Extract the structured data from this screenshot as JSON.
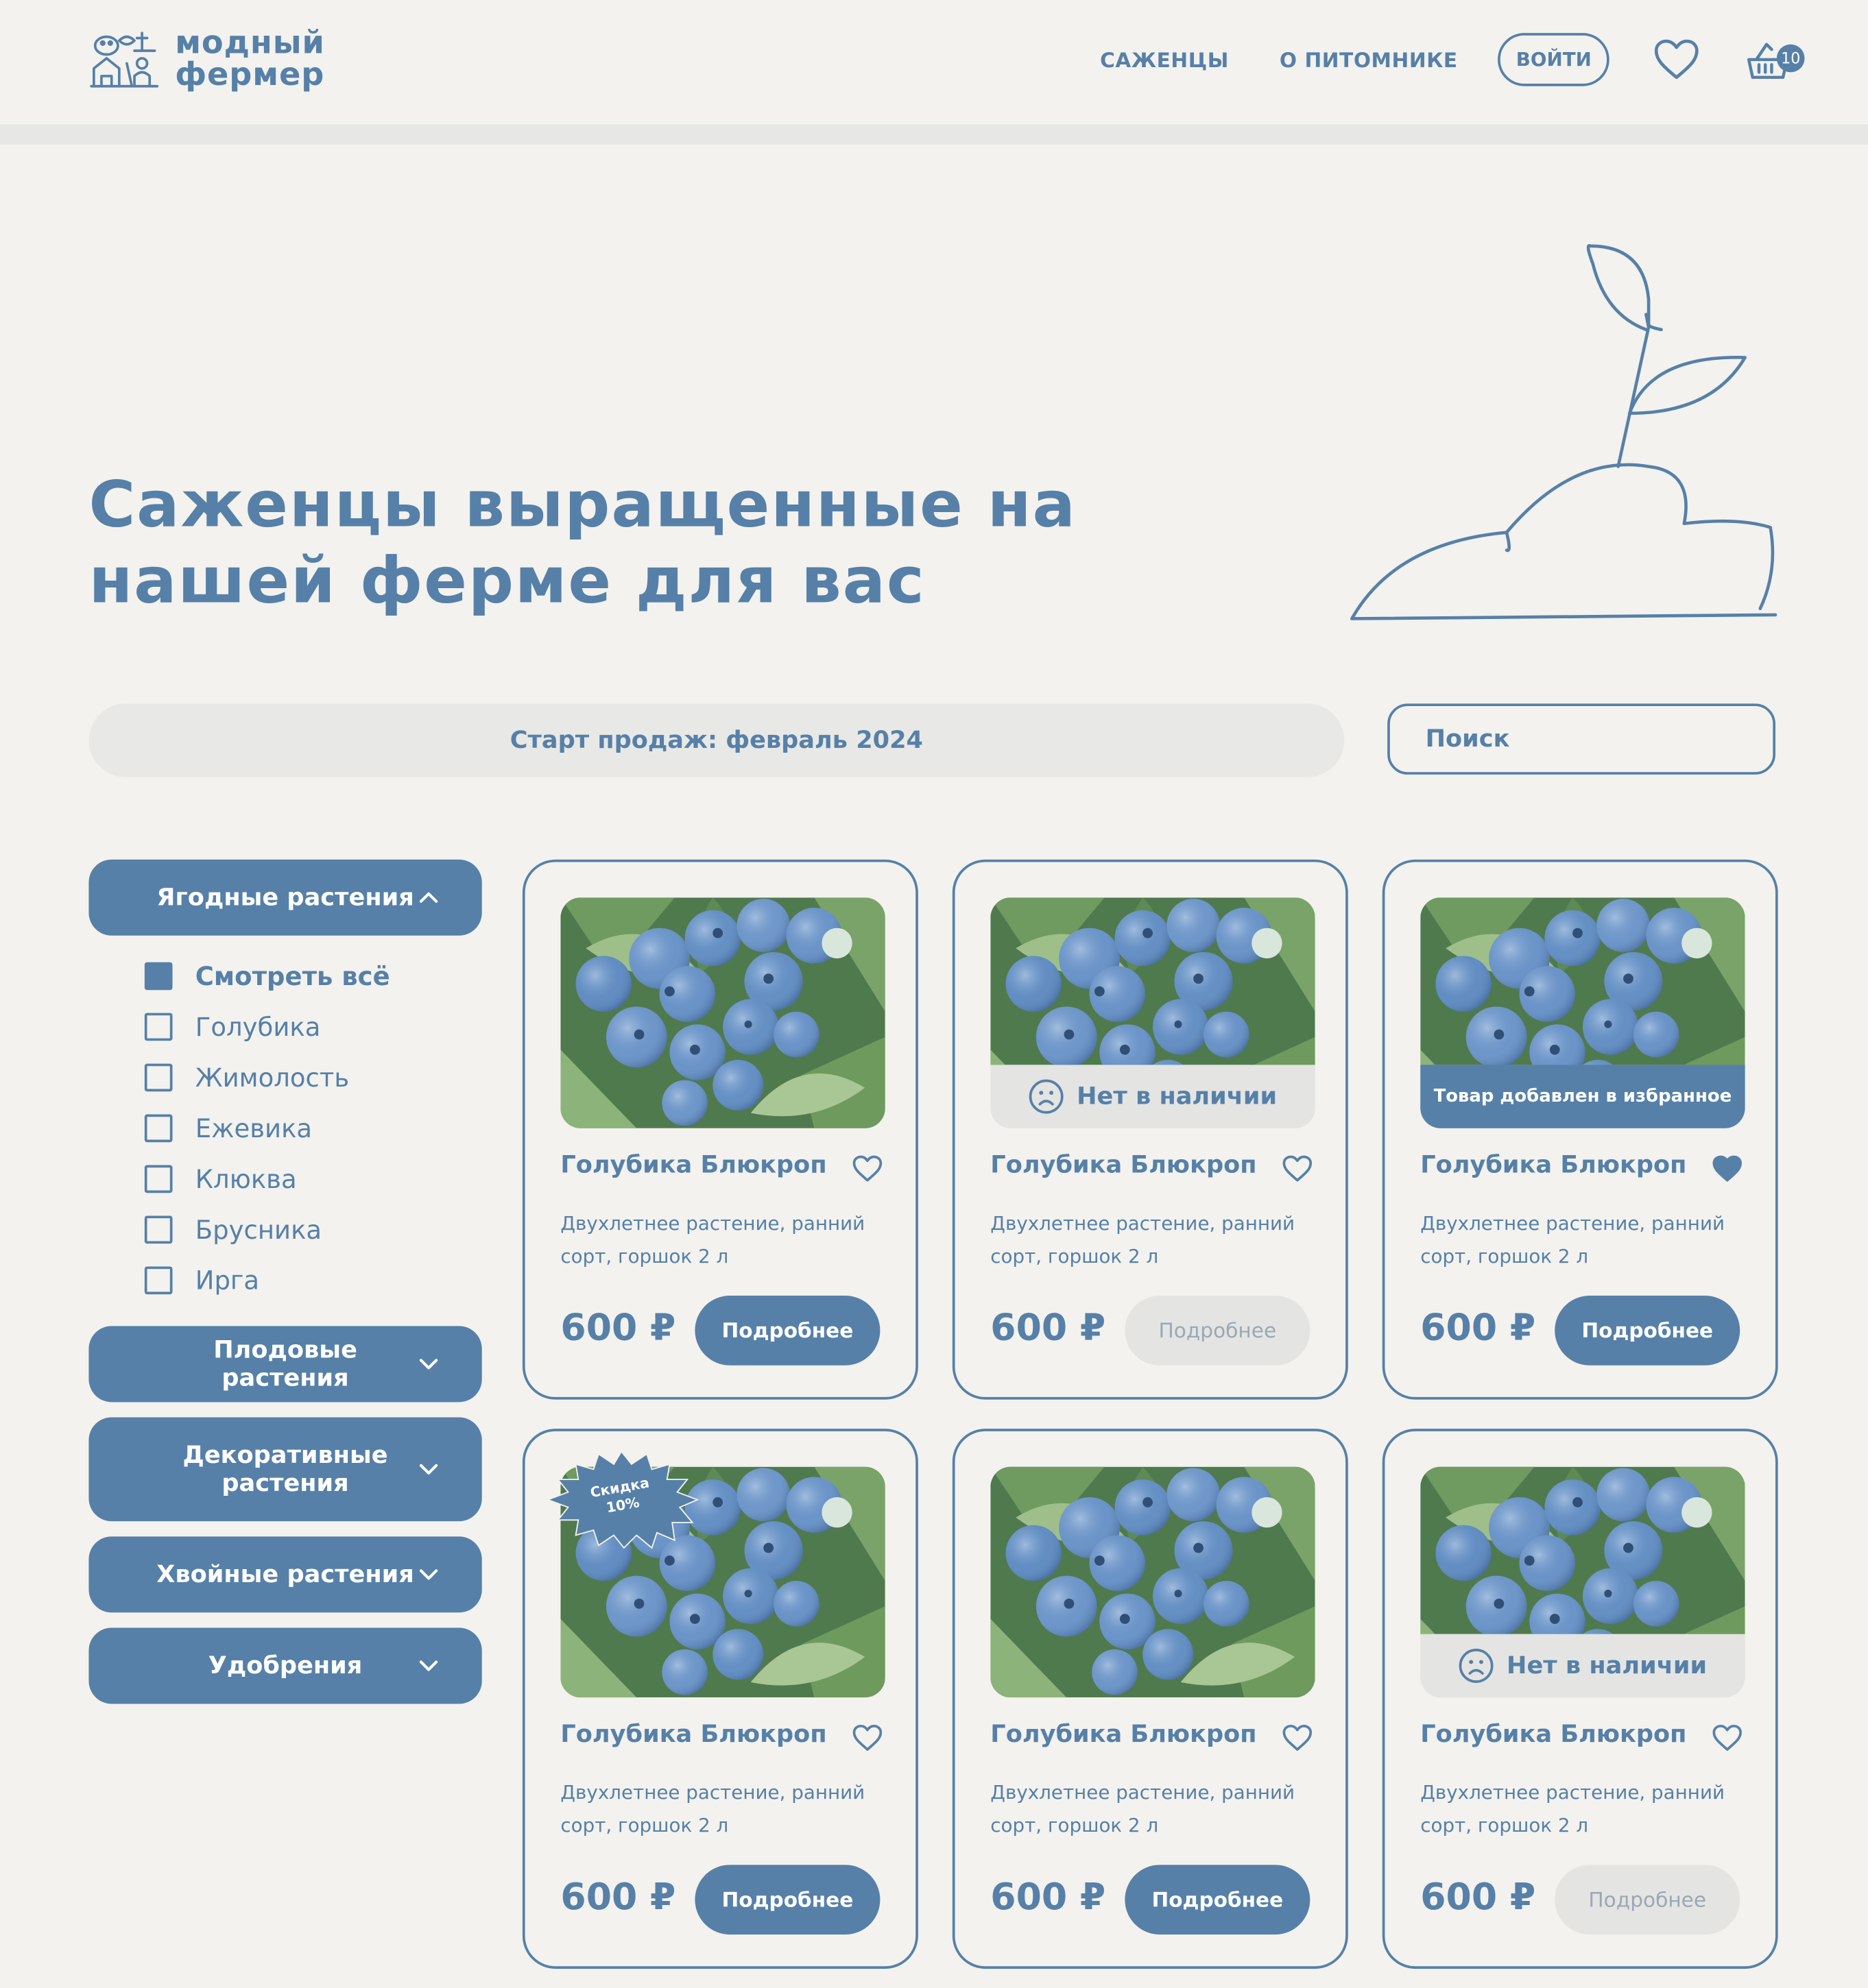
{
  "header": {
    "logo_line1": "модный",
    "logo_line2": "фермер",
    "nav": [
      "САЖЕНЦЫ",
      "О ПИТОМНИКЕ"
    ],
    "login": "ВОЙТИ",
    "cart_count": "10"
  },
  "hero": {
    "title": "Саженцы выращенные на нашей ферме для вас",
    "sale_notice": "Старт продаж: февраль 2024",
    "search_placeholder": "Поиск"
  },
  "sidebar": {
    "open_category": "Ягодные растения",
    "options": [
      {
        "label": "Смотреть всё",
        "checked": true
      },
      {
        "label": "Голубика",
        "checked": false
      },
      {
        "label": "Жимолость",
        "checked": false
      },
      {
        "label": "Ежевика",
        "checked": false
      },
      {
        "label": "Клюква",
        "checked": false
      },
      {
        "label": "Брусника",
        "checked": false
      },
      {
        "label": "Ирга",
        "checked": false
      }
    ],
    "categories": [
      "Плодовые растения",
      "Декоративные растения",
      "Хвойные растения",
      "Удобрения"
    ]
  },
  "products": [
    {
      "title": "Голубика Блюкроп",
      "desc": "Двухлетнее растение, ранний сорт, горшок 2 л",
      "price": "600 ₽",
      "button": "Подробнее",
      "status": "",
      "favorite": false,
      "badge": "",
      "available": true
    },
    {
      "title": "Голубика Блюкроп",
      "desc": "Двухлетнее растение, ранний сорт, горшок 2 л",
      "price": "600 ₽",
      "button": "Подробнее",
      "status": "Нет в наличии",
      "favorite": false,
      "badge": "",
      "available": false
    },
    {
      "title": "Голубика Блюкроп",
      "desc": "Двухлетнее растение, ранний сорт, горшок 2 л",
      "price": "600 ₽",
      "button": "Подробнее",
      "status": "Товар добавлен в избранное",
      "favorite": true,
      "badge": "",
      "available": true
    },
    {
      "title": "Голубика Блюкроп",
      "desc": "Двухлетнее растение, ранний сорт, горшок 2 л",
      "price": "600 ₽",
      "button": "Подробнее",
      "status": "",
      "favorite": false,
      "badge_line1": "Скидка",
      "badge_line2": "10%",
      "available": true
    },
    {
      "title": "Голубика Блюкроп",
      "desc": "Двухлетнее растение, ранний сорт, горшок 2 л",
      "price": "600 ₽",
      "button": "Подробнее",
      "status": "",
      "favorite": false,
      "badge": "",
      "available": true
    },
    {
      "title": "Голубика Блюкроп",
      "desc": "Двухлетнее растение, ранний сорт, горшок 2 л",
      "price": "600 ₽",
      "button": "Подробнее",
      "status": "Нет в наличии",
      "favorite": false,
      "badge": "",
      "available": false
    }
  ],
  "colors": {
    "accent": "#5680a8",
    "background": "#f3f2ee",
    "muted": "#e4e4e2"
  },
  "icons": [
    "logo-farm-icon",
    "heart-icon",
    "cart-icon",
    "search-icon",
    "chevron-down-icon",
    "sad-face-icon",
    "sprout-illustration"
  ]
}
